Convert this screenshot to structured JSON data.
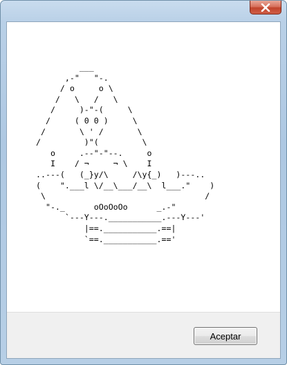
{
  "window": {
    "close_icon": "close-x-icon",
    "close_color": "#c7412a"
  },
  "message": {
    "ascii_art": "         ___\n      ,-\"   \"-.\n     / o     o \\\n    /   \\   /   \\\n   /     )-\"-(     \\\n  /     ( 0 0 )     \\\n /       \\ ' /       \\\n/         )\"(         \\\n   o     .--\"-\"--.     o\n   I    / ¬     ¬ \\    I\n..---(   (_}y/\\     /\\y{_)   )---..\n(    \".___l \\/__\\___/__\\  l___.\"    )\n \\                                 /\n  \"-._      oOoOoOo      _.-\"\n      `---Y---.___________.---Y---'\n          |==.___________.==|\n          `==.___________.=='"
  },
  "footer": {
    "ok_label": "Aceptar"
  }
}
